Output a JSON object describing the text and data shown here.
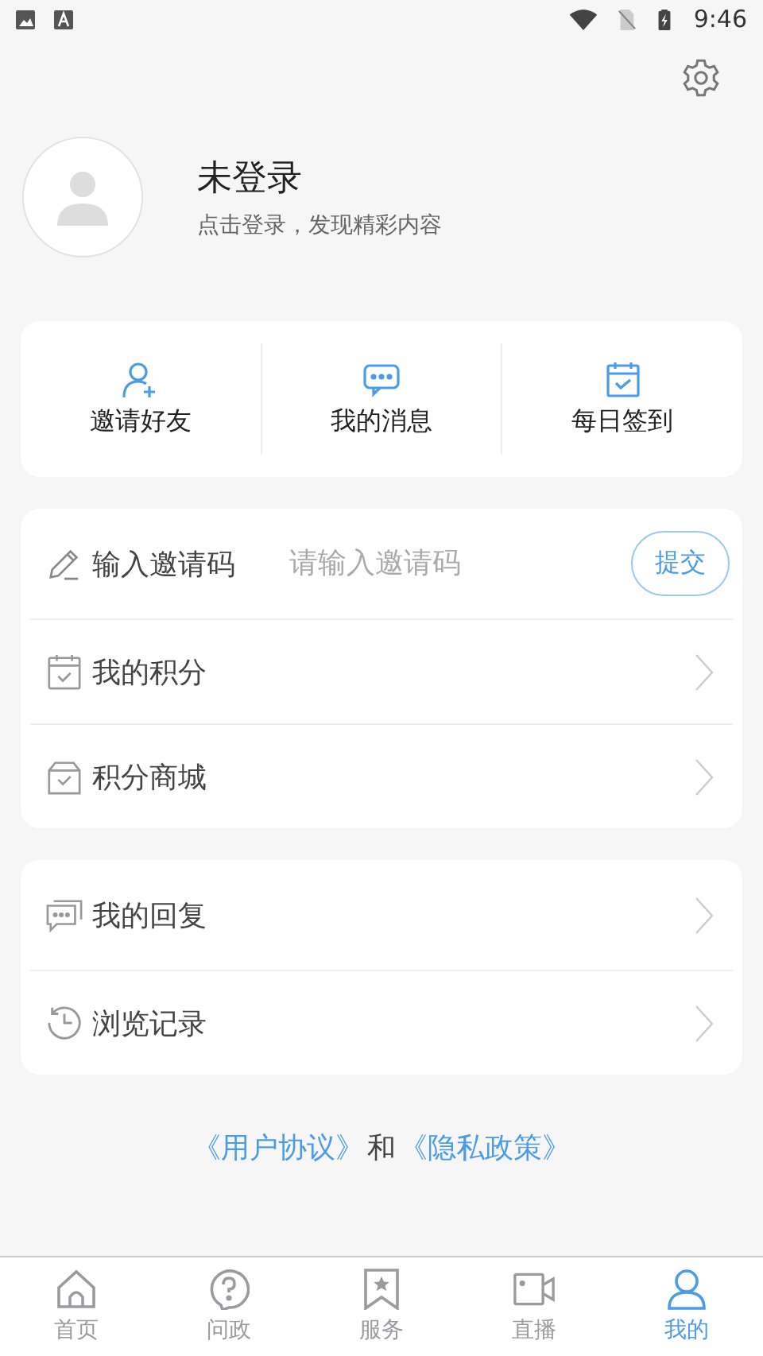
{
  "status_bar": {
    "time": "9:46"
  },
  "profile": {
    "name": "未登录",
    "subtitle": "点击登录，发现精彩内容"
  },
  "quick_actions": [
    {
      "kind": "invite",
      "label": "邀请好友"
    },
    {
      "kind": "message",
      "label": "我的消息"
    },
    {
      "kind": "checkin",
      "label": "每日签到"
    }
  ],
  "invite_code": {
    "label": "输入邀请码",
    "placeholder": "请输入邀请码",
    "button": "提交"
  },
  "menu_groups": [
    [
      {
        "kind": "points",
        "label": "我的积分"
      },
      {
        "kind": "mall",
        "label": "积分商城"
      }
    ],
    [
      {
        "kind": "reply",
        "label": "我的回复"
      },
      {
        "kind": "history",
        "label": "浏览记录"
      }
    ]
  ],
  "agreement": {
    "user_agreement": "《用户协议》",
    "connector": "和",
    "privacy_policy": "《隐私政策》"
  },
  "tabs": [
    {
      "kind": "home",
      "label": "首页",
      "selected": false
    },
    {
      "kind": "question",
      "label": "问政",
      "selected": false
    },
    {
      "kind": "service",
      "label": "服务",
      "selected": false
    },
    {
      "kind": "live",
      "label": "直播",
      "selected": false
    },
    {
      "kind": "me",
      "label": "我的",
      "selected": true
    }
  ]
}
